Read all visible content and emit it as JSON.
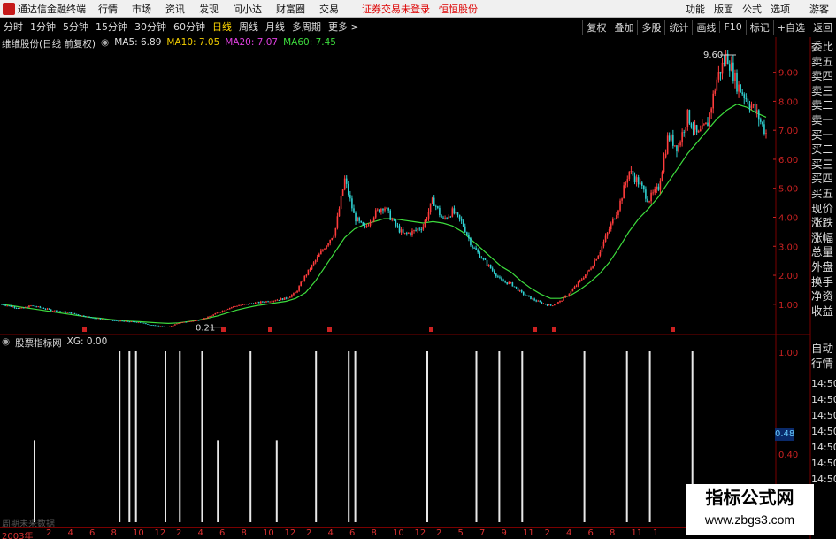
{
  "menubar": {
    "app_title": "通达信金融终端",
    "items": [
      "行情",
      "市场",
      "资讯",
      "发现",
      "问小达",
      "财富圈",
      "交易"
    ],
    "notice_1": "证券交易未登录",
    "notice_2": "恒恒股份",
    "right_items": [
      "功能",
      "版面",
      "公式",
      "选项"
    ],
    "guest": "游客"
  },
  "period_bar": {
    "items": [
      "分时",
      "1分钟",
      "5分钟",
      "15分钟",
      "30分钟",
      "60分钟",
      "日线",
      "周线",
      "月线",
      "多周期",
      "更多 >"
    ],
    "active": "日线",
    "right_buttons": [
      "复权",
      "叠加",
      "多股",
      "统计",
      "画线",
      "F10",
      "标记",
      "+自选",
      "返回"
    ]
  },
  "main_legend": {
    "stock": "维维股份(日线 前复权)",
    "ma5": "MA5: 6.89",
    "ma10": "MA10: 7.05",
    "ma20": "MA20: 7.07",
    "ma60": "MA60: 7.45"
  },
  "sub_legend": {
    "name": "股票指标网",
    "xg": "XG: 0.00"
  },
  "side_panel": [
    "委比",
    "卖五",
    "卖四",
    "卖三",
    "卖二",
    "卖一",
    "买一",
    "买二",
    "买三",
    "买四",
    "买五",
    "现价",
    "涨跌",
    "涨幅",
    "总量",
    "外盘",
    "换手",
    "净资",
    "收益"
  ],
  "side_panel_2": [
    "自动",
    "行情"
  ],
  "sub_ticks": [
    "1.00",
    "14:50",
    "14:50",
    "14:50",
    "14:50",
    "14:50",
    "0.40",
    "14:50",
    "14:50"
  ],
  "value_box": "0.48",
  "watermark": {
    "title": "指标公式网",
    "url": "www.zbgs3.com"
  },
  "bottom_note": "周期未来数据",
  "time_axis": {
    "year_label": "2003年",
    "labels": [
      "2",
      "4",
      "6",
      "8",
      "10",
      "12",
      "2",
      "4",
      "6",
      "8",
      "10",
      "12",
      "2",
      "4",
      "6",
      "8",
      "10",
      "12",
      "2",
      "5",
      "7",
      "9",
      "11",
      "2",
      "4",
      "6",
      "8",
      "11",
      "1"
    ]
  },
  "colors": {
    "ma5": "#e0e0e0",
    "ma10": "#f5d000",
    "ma20": "#e040e0",
    "ma60": "#3ddc3d",
    "up": "#ff3c3c",
    "down": "#2fd0d0",
    "axis_red": "#cc2222"
  },
  "chart_data": {
    "type": "line",
    "title": "维维股份(日线 前复权)",
    "y_ticks": [
      "9.00",
      "8.00",
      "7.00",
      "6.00",
      "5.00",
      "4.00",
      "3.00",
      "2.00",
      "1.00"
    ],
    "ylim": [
      0.2,
      9.6
    ],
    "max_label": "9.60",
    "min_label": "0.21",
    "price_path": [
      1.0,
      0.92,
      0.85,
      0.95,
      0.88,
      0.8,
      0.75,
      0.7,
      0.62,
      0.55,
      0.5,
      0.45,
      0.42,
      0.4,
      0.38,
      0.3,
      0.25,
      0.21,
      0.35,
      0.4,
      0.45,
      0.55,
      0.7,
      0.85,
      0.95,
      1.0,
      1.05,
      1.1,
      1.15,
      1.2,
      1.4,
      2.0,
      2.5,
      3.0,
      3.5,
      5.3,
      4.0,
      3.6,
      4.1,
      4.4,
      3.8,
      3.4,
      3.5,
      3.7,
      4.6,
      3.9,
      4.2,
      3.8,
      3.0,
      2.6,
      2.2,
      1.8,
      1.7,
      1.4,
      1.2,
      1.05,
      0.95,
      1.1,
      1.4,
      1.8,
      2.2,
      2.8,
      3.6,
      4.4,
      5.6,
      5.2,
      4.6,
      5.0,
      6.8,
      6.4,
      7.5,
      6.8,
      7.2,
      8.8,
      9.6,
      8.6,
      8.1,
      7.6,
      6.9
    ],
    "ma60_path": [
      1.0,
      0.95,
      0.9,
      0.85,
      0.8,
      0.75,
      0.7,
      0.65,
      0.6,
      0.55,
      0.52,
      0.48,
      0.45,
      0.42,
      0.4,
      0.38,
      0.36,
      0.34,
      0.36,
      0.4,
      0.45,
      0.52,
      0.6,
      0.7,
      0.8,
      0.88,
      0.95,
      1.0,
      1.05,
      1.1,
      1.2,
      1.4,
      1.8,
      2.3,
      2.8,
      3.3,
      3.6,
      3.75,
      3.85,
      3.95,
      3.95,
      3.9,
      3.85,
      3.8,
      3.85,
      3.8,
      3.7,
      3.5,
      3.2,
      2.9,
      2.6,
      2.3,
      2.1,
      1.8,
      1.55,
      1.35,
      1.2,
      1.2,
      1.3,
      1.5,
      1.75,
      2.05,
      2.45,
      2.95,
      3.5,
      3.95,
      4.3,
      4.7,
      5.2,
      5.7,
      6.2,
      6.6,
      7.0,
      7.4,
      7.7,
      7.9,
      7.8,
      7.6,
      7.45
    ]
  },
  "sub_chart_data": {
    "type": "bar",
    "series_name": "XG",
    "spikes": [
      {
        "t": 0.05,
        "v": 0.48
      },
      {
        "t": 0.18,
        "v": 1.0
      },
      {
        "t": 0.195,
        "v": 1.0
      },
      {
        "t": 0.205,
        "v": 1.0
      },
      {
        "t": 0.25,
        "v": 1.0
      },
      {
        "t": 0.272,
        "v": 1.0
      },
      {
        "t": 0.306,
        "v": 1.0
      },
      {
        "t": 0.33,
        "v": 0.48
      },
      {
        "t": 0.38,
        "v": 1.0
      },
      {
        "t": 0.42,
        "v": 0.48
      },
      {
        "t": 0.48,
        "v": 1.0
      },
      {
        "t": 0.53,
        "v": 1.0
      },
      {
        "t": 0.54,
        "v": 1.0
      },
      {
        "t": 0.65,
        "v": 1.0
      },
      {
        "t": 0.725,
        "v": 1.0
      },
      {
        "t": 0.76,
        "v": 1.0
      },
      {
        "t": 0.795,
        "v": 1.0
      },
      {
        "t": 0.89,
        "v": 1.0
      },
      {
        "t": 0.955,
        "v": 1.0
      },
      {
        "t": 0.99,
        "v": 1.0
      },
      {
        "t": 1.055,
        "v": 1.0
      }
    ],
    "ylim": [
      0,
      1.0
    ]
  }
}
